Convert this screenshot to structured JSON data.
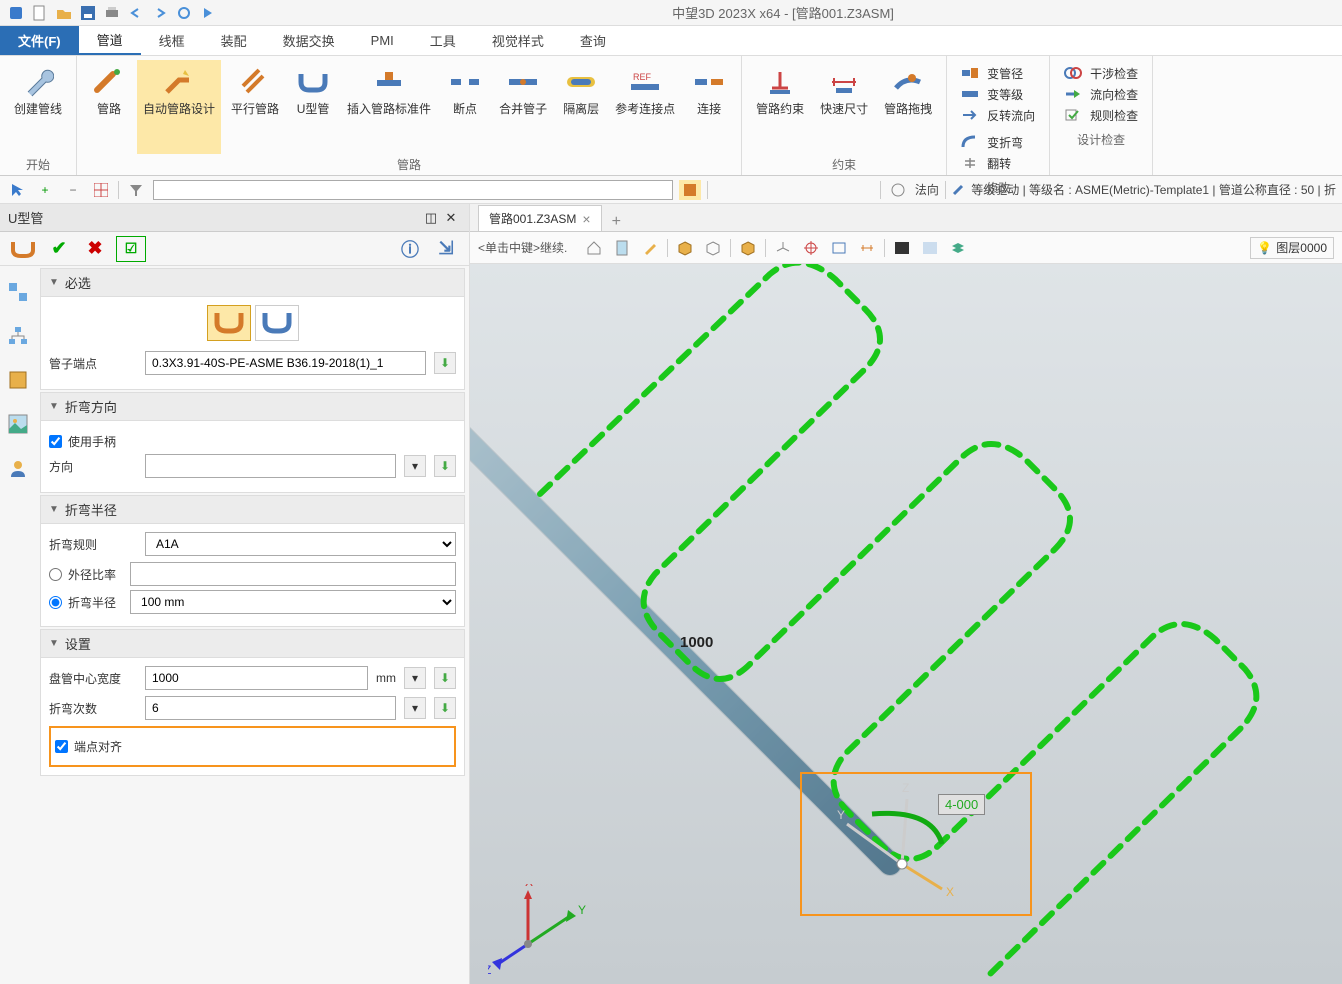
{
  "app": {
    "title": "中望3D 2023X x64 - [管路001.Z3ASM]"
  },
  "menu": {
    "file": "文件(F)",
    "tabs": [
      "管道",
      "线框",
      "装配",
      "数据交换",
      "PMI",
      "工具",
      "视觉样式",
      "查询"
    ],
    "active": 0
  },
  "ribbon": {
    "groups": [
      {
        "label": "开始",
        "items": [
          {
            "name": "创建管线"
          }
        ]
      },
      {
        "label": "管路",
        "items": [
          {
            "name": "管路"
          },
          {
            "name": "自动管路设计",
            "hl": true
          },
          {
            "name": "平行管路"
          },
          {
            "name": "U型管"
          },
          {
            "name": "插入管路标准件"
          },
          {
            "name": "断点"
          },
          {
            "name": "合并管子"
          },
          {
            "name": "隔离层"
          },
          {
            "name": "参考连接点"
          },
          {
            "name": "连接"
          }
        ]
      },
      {
        "label": "约束",
        "items": [
          {
            "name": "管路约束"
          },
          {
            "name": "快速尺寸"
          },
          {
            "name": "管路拖拽"
          }
        ]
      },
      {
        "label": "修改",
        "small": true,
        "items": [
          {
            "name": "变管径"
          },
          {
            "name": "变折弯"
          },
          {
            "name": "变等级"
          },
          {
            "name": "翻转"
          },
          {
            "name": "反转流向"
          }
        ]
      },
      {
        "label": "设计检查",
        "small": true,
        "items": [
          {
            "name": "干涉检查"
          },
          {
            "name": "流向检查"
          },
          {
            "name": "规则检查"
          }
        ]
      }
    ]
  },
  "toolbar2": {
    "normal": "法向",
    "status": "等级驱动 | 等级名 : ASME(Metric)-Template1 | 管道公称直径 : 50 | 折"
  },
  "panel": {
    "title": "U型管",
    "sections": {
      "required": {
        "title": "必选",
        "endpoint_label": "管子端点",
        "endpoint_value": "0.3X3.91-40S-PE-ASME B36.19-2018(1)_1"
      },
      "bendDir": {
        "title": "折弯方向",
        "use_handle": "使用手柄",
        "dir_label": "方向"
      },
      "bendRadius": {
        "title": "折弯半径",
        "rule_label": "折弯规则",
        "rule_value": "A1A",
        "ratio_label": "外径比率",
        "radius_label": "折弯半径",
        "radius_value": "100 mm"
      },
      "settings": {
        "title": "设置",
        "coil_label": "盘管中心宽度",
        "coil_value": "1000",
        "coil_unit": "mm",
        "count_label": "折弯次数",
        "count_value": "6",
        "align_label": "端点对齐"
      }
    }
  },
  "viewport": {
    "tab": "管路001.Z3ASM",
    "hint": "<单击中键>继续.",
    "layer": "图层0000",
    "dimension": "1000",
    "valueBox": "4-000"
  }
}
